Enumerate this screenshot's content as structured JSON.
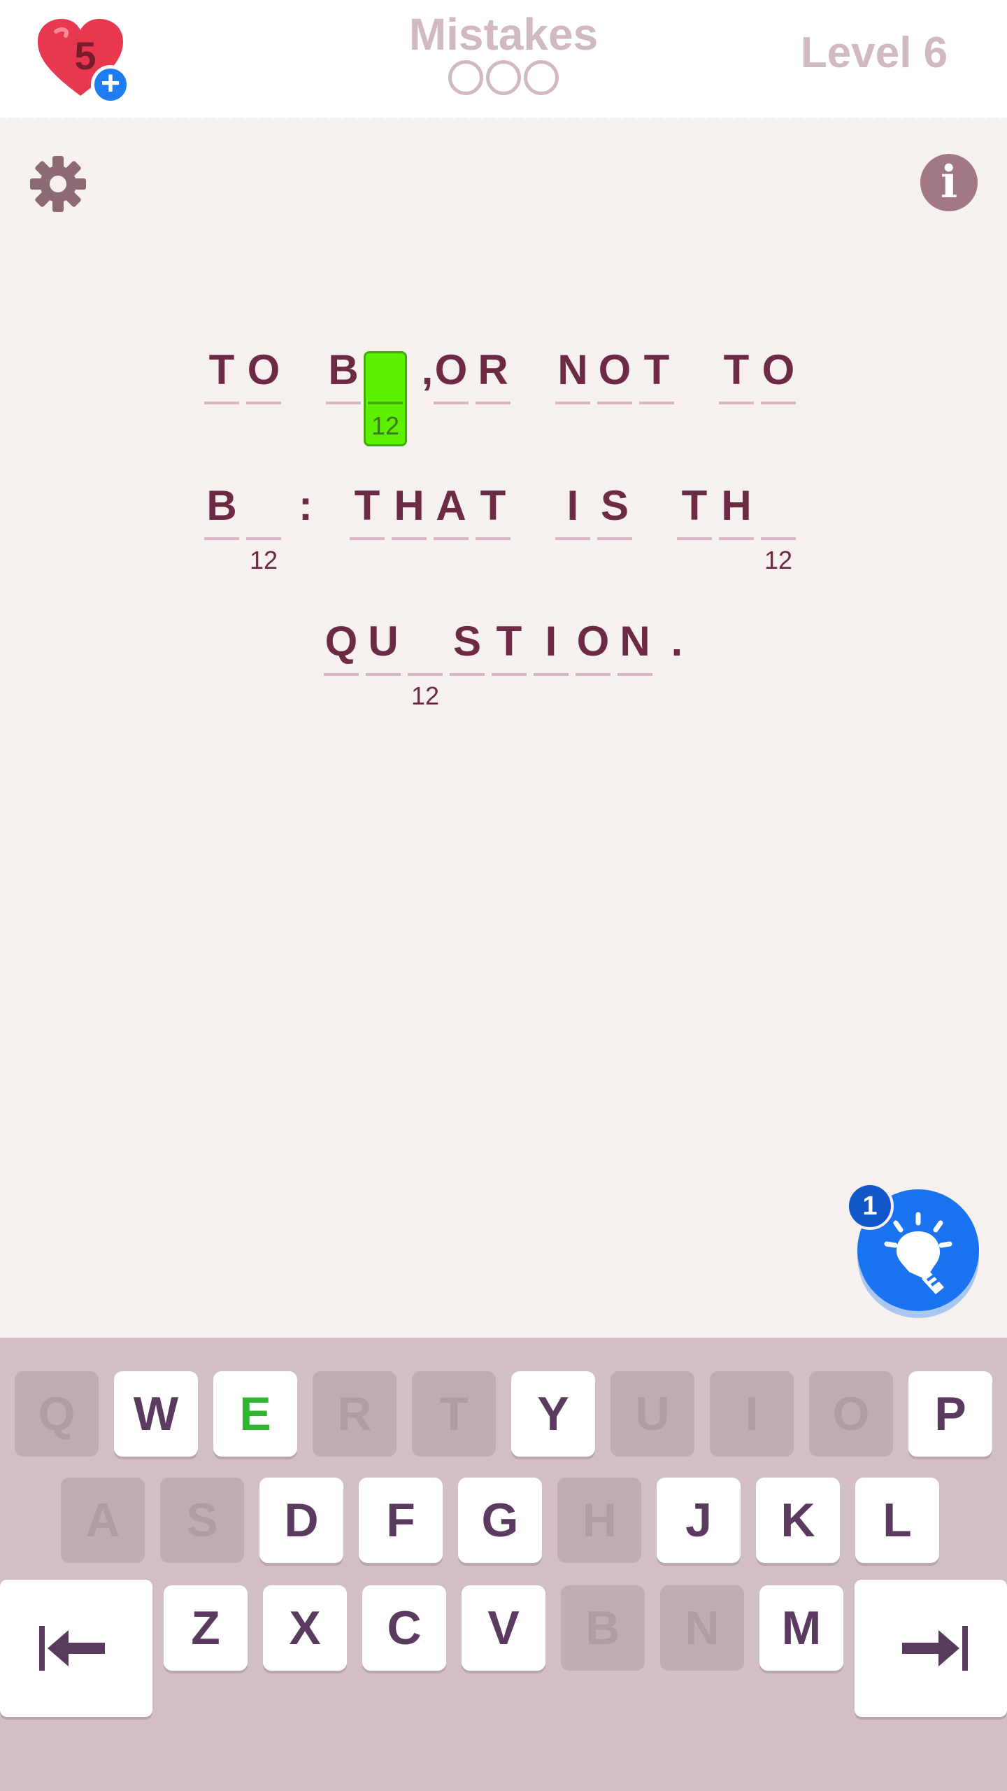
{
  "header": {
    "lives": "5",
    "plus_label": "+",
    "mistakes_title": "Mistakes",
    "level_label": "Level 6",
    "mistake_slots": 3
  },
  "info_label": "i",
  "hint": {
    "count": "1"
  },
  "puzzle": {
    "rows": [
      [
        {
          "ch": "T"
        },
        {
          "ch": "O"
        },
        {
          "gap": true
        },
        {
          "ch": "B"
        },
        {
          "ch": "",
          "num": "12",
          "selected": true
        },
        {
          "ch": ",",
          "punct": true
        },
        {
          "ch": "O"
        },
        {
          "ch": "R"
        },
        {
          "gap": true
        },
        {
          "ch": "N"
        },
        {
          "ch": "O"
        },
        {
          "ch": "T"
        },
        {
          "gap": true
        },
        {
          "ch": "T"
        },
        {
          "ch": "O"
        }
      ],
      [
        {
          "ch": "B"
        },
        {
          "ch": "",
          "num": "12"
        },
        {
          "ch": ":",
          "punct": true
        },
        {
          "gap": true
        },
        {
          "ch": "T"
        },
        {
          "ch": "H"
        },
        {
          "ch": "A"
        },
        {
          "ch": "T"
        },
        {
          "gap": true
        },
        {
          "ch": "I"
        },
        {
          "ch": "S"
        },
        {
          "gap": true
        },
        {
          "ch": "T"
        },
        {
          "ch": "H"
        },
        {
          "ch": "",
          "num": "12"
        }
      ],
      [
        {
          "ch": "Q"
        },
        {
          "ch": "U"
        },
        {
          "ch": "",
          "num": "12"
        },
        {
          "ch": "S"
        },
        {
          "ch": "T"
        },
        {
          "ch": "I"
        },
        {
          "ch": "O"
        },
        {
          "ch": "N"
        },
        {
          "ch": ".",
          "punct": true
        }
      ]
    ]
  },
  "keyboard": {
    "rows": [
      [
        {
          "k": "Q",
          "state": "disabled"
        },
        {
          "k": "W",
          "state": "active"
        },
        {
          "k": "E",
          "state": "found"
        },
        {
          "k": "R",
          "state": "disabled"
        },
        {
          "k": "T",
          "state": "disabled"
        },
        {
          "k": "Y",
          "state": "active"
        },
        {
          "k": "U",
          "state": "disabled"
        },
        {
          "k": "I",
          "state": "disabled"
        },
        {
          "k": "O",
          "state": "disabled"
        },
        {
          "k": "P",
          "state": "active"
        }
      ],
      [
        {
          "k": "A",
          "state": "disabled"
        },
        {
          "k": "S",
          "state": "disabled"
        },
        {
          "k": "D",
          "state": "active"
        },
        {
          "k": "F",
          "state": "active"
        },
        {
          "k": "G",
          "state": "active"
        },
        {
          "k": "H",
          "state": "disabled"
        },
        {
          "k": "J",
          "state": "active"
        },
        {
          "k": "K",
          "state": "active"
        },
        {
          "k": "L",
          "state": "active"
        }
      ],
      [
        {
          "k": "Z",
          "state": "active"
        },
        {
          "k": "X",
          "state": "active"
        },
        {
          "k": "C",
          "state": "active"
        },
        {
          "k": "V",
          "state": "active"
        },
        {
          "k": "B",
          "state": "disabled"
        },
        {
          "k": "N",
          "state": "disabled"
        },
        {
          "k": "M",
          "state": "active"
        }
      ]
    ],
    "prev_icon": "arrow-left-to-bar-icon",
    "next_icon": "arrow-right-to-bar-icon"
  },
  "colors": {
    "background": "#f6f0ef",
    "text": "#6d2a45",
    "selected": "#5ef003",
    "hint": "#1a73f0",
    "keyboard": "#d2bfc5"
  }
}
